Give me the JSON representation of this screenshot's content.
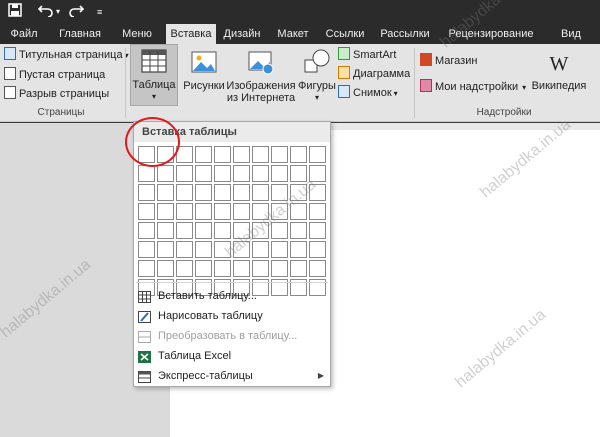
{
  "quick_access": {
    "save_icon": "save-icon",
    "undo_icon": "undo-icon",
    "redo_icon": "redo-icon",
    "customize_icon": "customize-icon"
  },
  "tabs": [
    {
      "label": "Файл"
    },
    {
      "label": "Главная"
    },
    {
      "label": "Меню"
    },
    {
      "label": "Вставка"
    },
    {
      "label": "Дизайн"
    },
    {
      "label": "Макет"
    },
    {
      "label": "Ссылки"
    },
    {
      "label": "Рассылки"
    },
    {
      "label": "Рецензирование"
    },
    {
      "label": "Вид"
    }
  ],
  "ribbon": {
    "pages": {
      "cover": "Титульная страница",
      "blank": "Пустая страница",
      "break": "Разрыв страницы",
      "group": "Страницы"
    },
    "table": {
      "label": "Таблица"
    },
    "illustrations": {
      "pictures": "Рисунки",
      "online_1": "Изображения",
      "online_2": "из Интернета",
      "shapes": "Фигуры",
      "smartart": "SmartArt",
      "chart": "Диаграмма",
      "screenshot": "Снимок"
    },
    "addins": {
      "store": "Магазин",
      "my_addins": "Мои надстройки",
      "wikipedia": "Википедия",
      "group": "Надстройки"
    }
  },
  "dropdown": {
    "title": "Вставка таблицы",
    "items": [
      {
        "label": "Вставить таблицу..."
      },
      {
        "label": "Нарисовать таблицу"
      },
      {
        "label": "Преобразовать в таблицу..."
      },
      {
        "label": "Таблица Excel"
      },
      {
        "label": "Экспресс-таблицы"
      }
    ]
  },
  "watermark": "halabydka.in.ua",
  "colors": {
    "ribbon_bg": "#e4e4e4",
    "tabbar_bg": "#2b2b2b",
    "annotation_red": "#e0191b",
    "office_red": "#d24726"
  }
}
